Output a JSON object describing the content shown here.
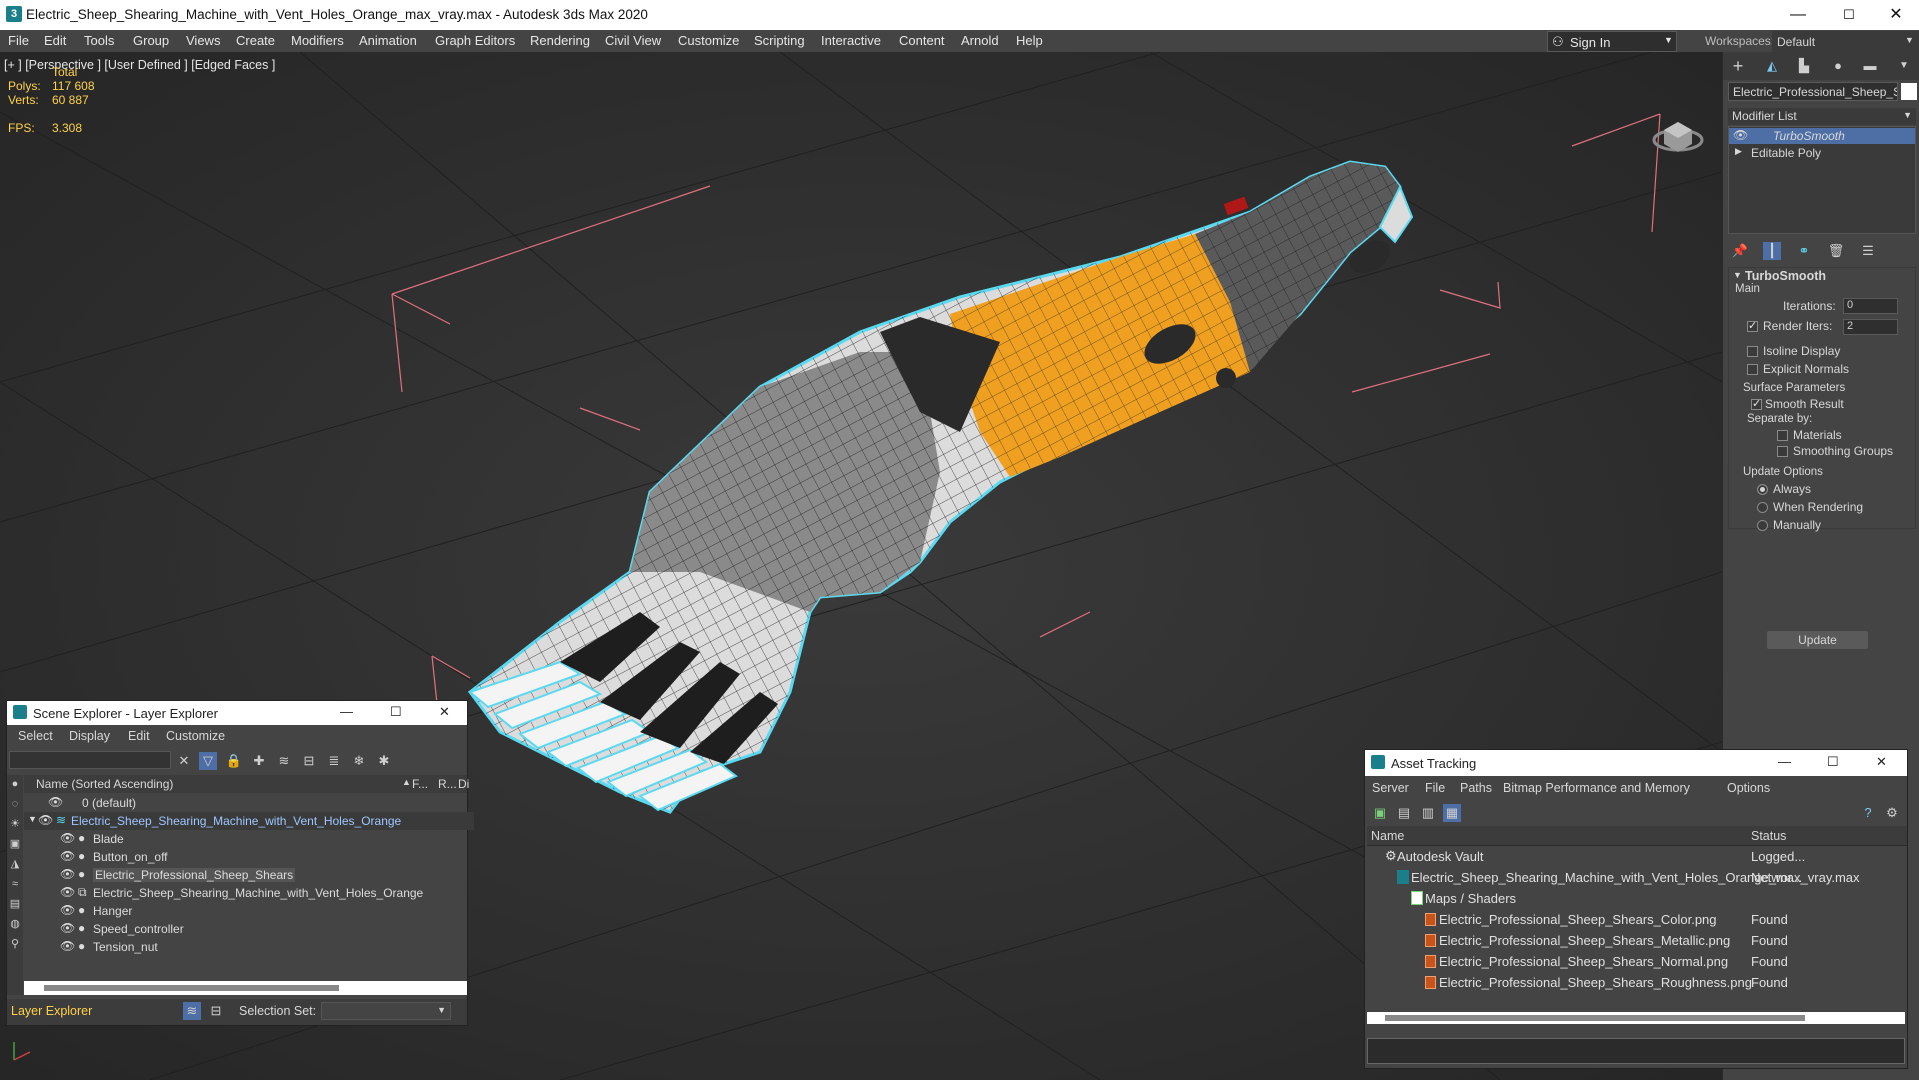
{
  "window": {
    "title": "Electric_Sheep_Shearing_Machine_with_Vent_Holes_Orange_max_vray.max - Autodesk 3ds Max 2020",
    "minimize": "—",
    "maximize": "☐",
    "close": "✕"
  },
  "menu": [
    "File",
    "Edit",
    "Tools",
    "Group",
    "Views",
    "Create",
    "Modifiers",
    "Animation",
    "Graph Editors",
    "Rendering",
    "Civil View",
    "Customize",
    "Scripting",
    "Interactive",
    "Content",
    "Arnold",
    "Help"
  ],
  "signin": {
    "label": "Sign In"
  },
  "workspaces": {
    "label": "Workspaces:",
    "value": "Default"
  },
  "viewport": {
    "label": "[+ ] [Perspective ] [User Defined ] [Edged Faces ]",
    "stats": {
      "total_label": "Total",
      "polys_label": "Polys:",
      "polys": "117 608",
      "verts_label": "Verts:",
      "verts": "60 887",
      "fps_label": "FPS:",
      "fps": "3.308"
    }
  },
  "command_panel": {
    "object_name": "Electric_Professional_Sheep_Sh",
    "modifier_list": "Modifier List",
    "stack": [
      "TurboSmooth",
      "Editable Poly"
    ],
    "rollout": "TurboSmooth",
    "main": "Main",
    "iterations_label": "Iterations:",
    "iterations": "0",
    "render_iters_label": "Render Iters:",
    "render_iters": "2",
    "isoline": "Isoline Display",
    "explicit_normals": "Explicit Normals",
    "surface_params": "Surface Parameters",
    "smooth_result": "Smooth Result",
    "separate_by": "Separate by:",
    "materials": "Materials",
    "smoothing_groups": "Smoothing Groups",
    "update_options": "Update Options",
    "always": "Always",
    "when_rendering": "When Rendering",
    "manually": "Manually",
    "update_button": "Update"
  },
  "scene_explorer": {
    "title": "Scene Explorer - Layer Explorer",
    "menu": [
      "Select",
      "Display",
      "Edit",
      "Customize"
    ],
    "col_name": "Name (Sorted Ascending)",
    "col_f": "F...",
    "col_r": "R...",
    "col_d": "Di",
    "rows": [
      {
        "name": "0 (default)",
        "level": 0
      },
      {
        "name": "Electric_Sheep_Shearing_Machine_with_Vent_Holes_Orange",
        "level": 0
      },
      {
        "name": "Blade",
        "level": 1
      },
      {
        "name": "Button_on_off",
        "level": 1
      },
      {
        "name": "Electric_Professional_Sheep_Shears",
        "level": 1
      },
      {
        "name": "Electric_Sheep_Shearing_Machine_with_Vent_Holes_Orange",
        "level": 1
      },
      {
        "name": "Hanger",
        "level": 1
      },
      {
        "name": "Speed_controller",
        "level": 1
      },
      {
        "name": "Tension_nut",
        "level": 1
      }
    ],
    "footer_label": "Layer Explorer",
    "selection_set": "Selection Set:"
  },
  "asset_tracking": {
    "title": "Asset Tracking",
    "menu": [
      "Server",
      "File",
      "Paths",
      "Bitmap Performance and Memory",
      "Options"
    ],
    "col_name": "Name",
    "col_status": "Status",
    "rows": [
      {
        "name": "Autodesk Vault",
        "status": "Logged..."
      },
      {
        "name": "Electric_Sheep_Shearing_Machine_with_Vent_Holes_Orange_max_vray.max",
        "status": "Networ..."
      },
      {
        "name": "Maps / Shaders",
        "status": ""
      },
      {
        "name": "Electric_Professional_Sheep_Shears_Color.png",
        "status": "Found"
      },
      {
        "name": "Electric_Professional_Sheep_Shears_Metallic.png",
        "status": "Found"
      },
      {
        "name": "Electric_Professional_Sheep_Shears_Normal.png",
        "status": "Found"
      },
      {
        "name": "Electric_Professional_Sheep_Shears_Roughness.png",
        "status": "Found"
      }
    ]
  },
  "colors": {
    "accent": "#f0a020",
    "selection": "#5ad9f0",
    "panel": "#444444",
    "highlight": "#4d6fa6"
  }
}
